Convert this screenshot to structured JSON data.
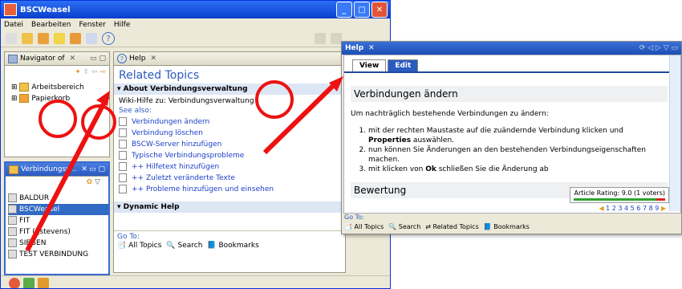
{
  "app": {
    "title": "BSCWeasel",
    "min": "_",
    "max": "□",
    "close": "✕"
  },
  "menu": [
    "Datei",
    "Bearbeiten",
    "Fenster",
    "Hilfe"
  ],
  "navigator": {
    "tab": "Navigator of",
    "items": [
      "Arbeitsbereich",
      "Papierkorb"
    ]
  },
  "connections": {
    "tab": "Verbindungsv...",
    "items": [
      "BALDUR",
      "BSCWeasel",
      "FIT",
      "FIT (gstevens)",
      "SIEGEN",
      "TEST VERBINDUNG"
    ],
    "selected": 1
  },
  "helppanel": {
    "tab": "Help",
    "heading": "Related Topics",
    "section1": "About Verbindungsverwaltung",
    "wiki": "Wiki-Hilfe zu: Verbindungsverwaltung",
    "see_also": "See also:",
    "links": [
      "Verbindungen ändern",
      "Verbindung löschen",
      "BSCW-Server hinzufügen",
      "Typische Verbindungsprobleme",
      "++ Hilfetext hinzufügen",
      "++ Zuletzt veränderte Texte",
      "++ Probleme hinzufügen und einsehen"
    ],
    "section2": "Dynamic Help",
    "goto": "Go To:",
    "nav": [
      "All Topics",
      "Search",
      "Bookmarks"
    ]
  },
  "helpwin": {
    "title": "Help",
    "tabs": [
      "View",
      "Edit"
    ],
    "h1": "Verbindungen ändern",
    "intro": "Um nachträglich bestehende Verbindungen zu ändern:",
    "steps": [
      {
        "pre": "mit der rechten Maustaste auf die zuändernde Verbindung klicken und ",
        "bold": "Properties",
        "post": " auswählen."
      },
      {
        "pre": "nun können Sie Änderungen an den bestehenden Verbindungseigenschaften machen.",
        "bold": "",
        "post": ""
      },
      {
        "pre": "mit klicken von ",
        "bold": "Ok",
        "post": " schließen Sie die Änderung ab"
      }
    ],
    "h2": "Bewertung",
    "rating": "Article Rating: 9.0 (1 voters)",
    "stars": "1 2 3 4 5 6 7 8 9",
    "goto": "Go To:",
    "nav": [
      "All Topics",
      "Search",
      "Related Topics",
      "Bookmarks"
    ]
  },
  "colors": {
    "annotation": "#ee1111",
    "titlebar": "#0a3fcc",
    "link": "#1a3fc7"
  }
}
